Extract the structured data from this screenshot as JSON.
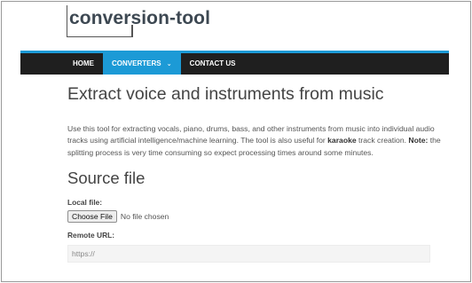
{
  "logo": {
    "text": "conversion-tool"
  },
  "nav": {
    "items": [
      {
        "label": "HOME"
      },
      {
        "label": "CONVERTERS",
        "caret": "⌄"
      },
      {
        "label": "CONTACT US"
      }
    ],
    "accent_color": "#1c9ad6",
    "bar_color": "#1f1f1f"
  },
  "main": {
    "title": "Extract voice and instruments from music",
    "description": {
      "part1": "Use this tool for extracting vocals, piano, drums, bass, and other instruments from music into individual audio tracks using artificial intelligence/machine learning. The tool is also useful for ",
      "bold1": "karaoke",
      "part2": " track creation. ",
      "bold2": "Note:",
      "part3": " the splitting process is very time consuming so expect processing times around some minutes."
    },
    "source_heading": "Source file",
    "local_file": {
      "label": "Local file:",
      "button": "Choose File",
      "status": "No file chosen"
    },
    "remote_url": {
      "label": "Remote URL:",
      "placeholder": "https://"
    }
  }
}
